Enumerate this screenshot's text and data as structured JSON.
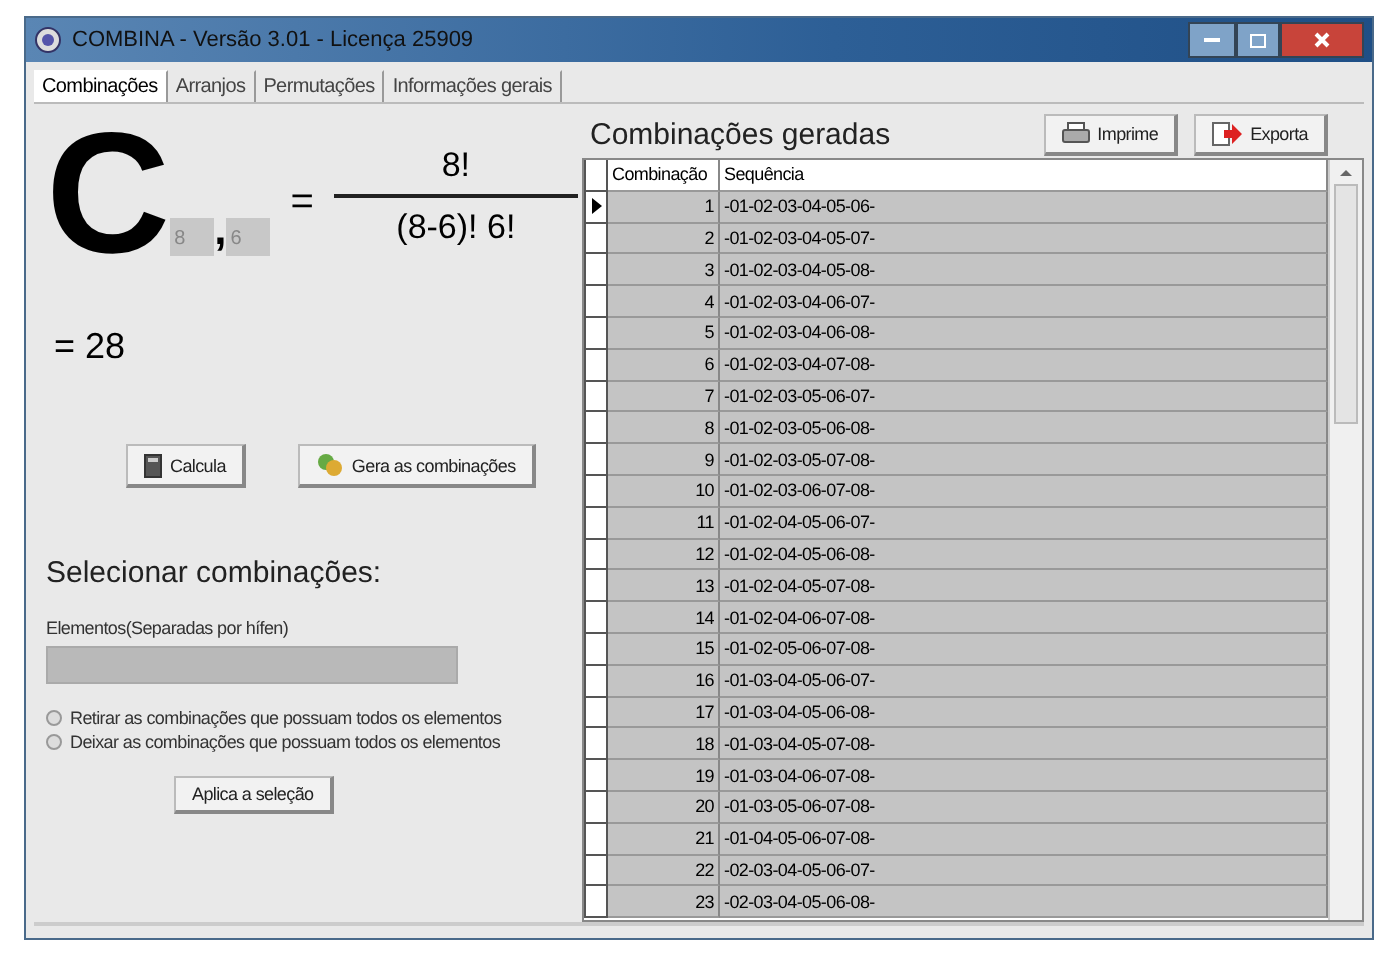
{
  "window": {
    "title": "COMBINA - Versão 3.01 - Licença 25909"
  },
  "tabs": [
    {
      "label": "Combinações",
      "selected": true
    },
    {
      "label": "Arranjos",
      "selected": false
    },
    {
      "label": "Permutações",
      "selected": false
    },
    {
      "label": "Informações gerais",
      "selected": false
    }
  ],
  "formula": {
    "symbol": "C",
    "n": "8",
    "comma": ",",
    "k": "6",
    "equals": "=",
    "numerator": "8!",
    "denominator": "(8-6)! 6!",
    "result": "= 28"
  },
  "actions": [
    {
      "label": "Calcula",
      "kind": "calculator"
    },
    {
      "label": "Gera as combinações",
      "kind": "generate"
    }
  ],
  "selection": {
    "title": "Selecionar combinações:",
    "field_label": "Elementos(Separadas por hífen)",
    "options": [
      {
        "label": "Retirar as combinações que possuam todos os elementos",
        "selected": false
      },
      {
        "label": "Deixar as combinações que possuam todos os elementos",
        "selected": false
      }
    ],
    "button": "Aplica a seleção"
  },
  "results": {
    "title": "Combinações geradas",
    "buttons": [
      {
        "label": "Imprime",
        "kind": "print"
      },
      {
        "label": "Exporta",
        "kind": "export"
      }
    ],
    "columns": [
      "Combinação",
      "Sequência"
    ],
    "rows": [
      {
        "n": "1",
        "seq": "-01-02-03-04-05-06-",
        "selected": true
      },
      {
        "n": "2",
        "seq": "-01-02-03-04-05-07-",
        "selected": false
      },
      {
        "n": "3",
        "seq": "-01-02-03-04-05-08-",
        "selected": false
      },
      {
        "n": "4",
        "seq": "-01-02-03-04-06-07-",
        "selected": false
      },
      {
        "n": "5",
        "seq": "-01-02-03-04-06-08-",
        "selected": false
      },
      {
        "n": "6",
        "seq": "-01-02-03-04-07-08-",
        "selected": false
      },
      {
        "n": "7",
        "seq": "-01-02-03-05-06-07-",
        "selected": false
      },
      {
        "n": "8",
        "seq": "-01-02-03-05-06-08-",
        "selected": false
      },
      {
        "n": "9",
        "seq": "-01-02-03-05-07-08-",
        "selected": false
      },
      {
        "n": "10",
        "seq": "-01-02-03-06-07-08-",
        "selected": false
      },
      {
        "n": "11",
        "seq": "-01-02-04-05-06-07-",
        "selected": false
      },
      {
        "n": "12",
        "seq": "-01-02-04-05-06-08-",
        "selected": false
      },
      {
        "n": "13",
        "seq": "-01-02-04-05-07-08-",
        "selected": false
      },
      {
        "n": "14",
        "seq": "-01-02-04-06-07-08-",
        "selected": false
      },
      {
        "n": "15",
        "seq": "-01-02-05-06-07-08-",
        "selected": false
      },
      {
        "n": "16",
        "seq": "-01-03-04-05-06-07-",
        "selected": false
      },
      {
        "n": "17",
        "seq": "-01-03-04-05-06-08-",
        "selected": false
      },
      {
        "n": "18",
        "seq": "-01-03-04-05-07-08-",
        "selected": false
      },
      {
        "n": "19",
        "seq": "-01-03-04-06-07-08-",
        "selected": false
      },
      {
        "n": "20",
        "seq": "-01-03-05-06-07-08-",
        "selected": false
      },
      {
        "n": "21",
        "seq": "-01-04-05-06-07-08-",
        "selected": false
      },
      {
        "n": "22",
        "seq": "-02-03-04-05-06-07-",
        "selected": false
      },
      {
        "n": "23",
        "seq": "-02-03-04-05-06-08-",
        "selected": false
      }
    ]
  }
}
